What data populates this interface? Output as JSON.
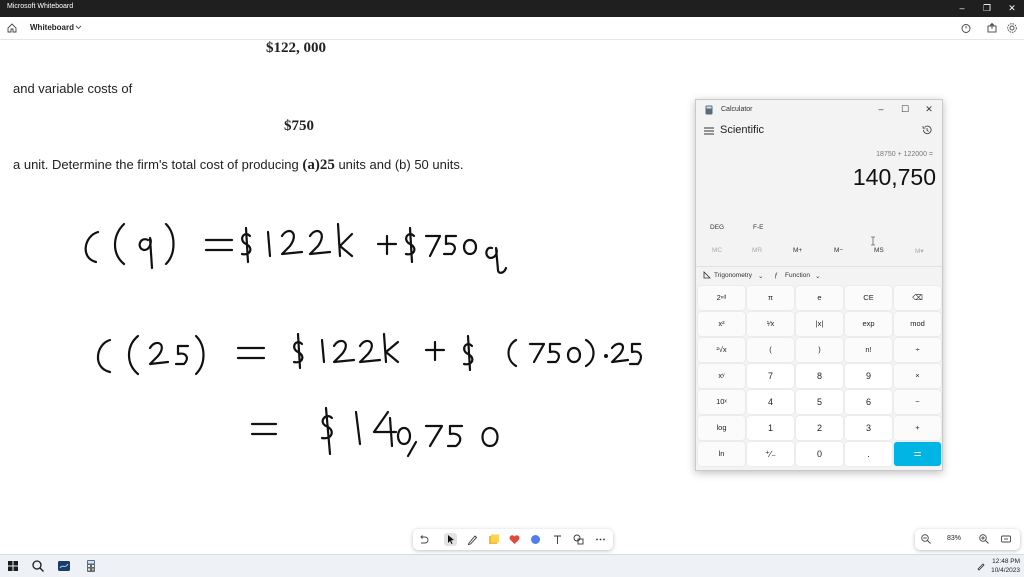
{
  "window": {
    "title": "Microsoft Whiteboard"
  },
  "toolbar": {
    "board_name": "Whiteboard"
  },
  "whiteboard": {
    "fixed_cost": "$122, 000",
    "variable_text": "and variable costs of",
    "variable_cost": "$750",
    "question_start": "a unit. Determine the firm's total cost of producing ",
    "question_a": "(a)25",
    "question_end": " units and (b) 50 units.",
    "handwritten": {
      "line1": "C(q) = $122k + $750q",
      "line2": "C(25) = $122k + $(750)·25",
      "line3": "= $140,750"
    }
  },
  "calculator": {
    "title": "Calculator",
    "mode": "Scientific",
    "expression": "18750 + 122000 =",
    "result": "140,750",
    "angle": "DEG",
    "fe": "F-E",
    "memory": [
      "MC",
      "MR",
      "M+",
      "M−",
      "MS",
      "M▾"
    ],
    "functions": {
      "trig": "Trigonometry",
      "func": "Function"
    },
    "keys": [
      [
        "2ⁿᵈ",
        "π",
        "e",
        "CE",
        "⌫"
      ],
      [
        "x²",
        "¹⁄x",
        "|x|",
        "exp",
        "mod"
      ],
      [
        "²√x",
        "(",
        ")",
        "n!",
        "÷"
      ],
      [
        "xʸ",
        "7",
        "8",
        "9",
        "×"
      ],
      [
        "10ˣ",
        "4",
        "5",
        "6",
        "−"
      ],
      [
        "log",
        "1",
        "2",
        "3",
        "+"
      ],
      [
        "ln",
        "⁺∕₋",
        "0",
        ".",
        "="
      ]
    ]
  },
  "zoom": {
    "level": "83%"
  },
  "taskbar": {
    "time": "12:48 PM",
    "date": "10/4/2023"
  }
}
